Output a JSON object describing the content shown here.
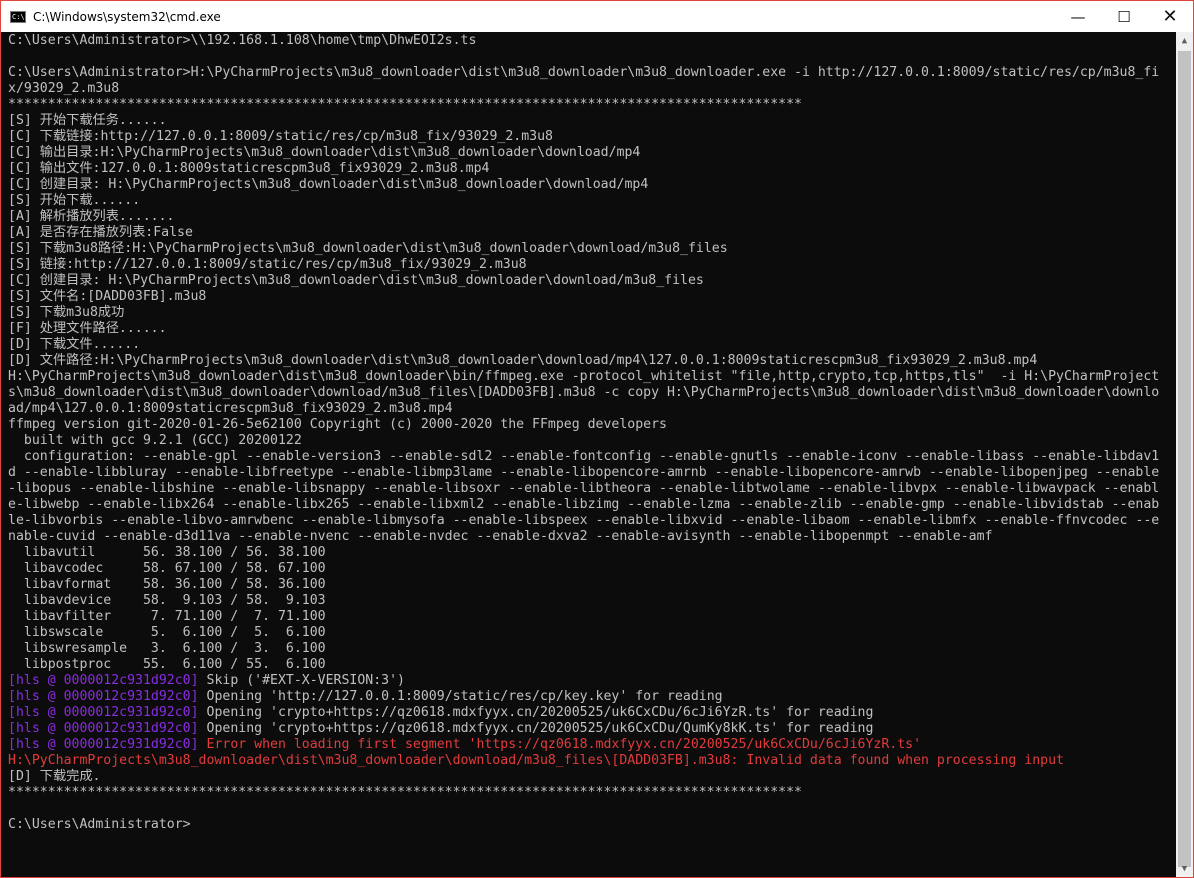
{
  "window": {
    "title": "C:\\Windows\\system32\\cmd.exe",
    "icon": "cmd-icon",
    "icon_glyph": "C:\\",
    "controls": {
      "minimize": "—",
      "maximize": "☐",
      "close": "✕"
    }
  },
  "colors": {
    "background": "#0c0c0c",
    "text": "#c0c0c0",
    "hls_tag": "#8a2be2",
    "error": "#e23b3b",
    "frame": "#e0443e"
  },
  "scrollbar": {
    "up": "▲",
    "down": "▼"
  },
  "console": {
    "lines": [
      {
        "text": "C:\\Users\\Administrator>\\\\192.168.1.108\\home\\tmp\\DhwEOI2s.ts"
      },
      {
        "text": ""
      },
      {
        "text": "C:\\Users\\Administrator>H:\\PyCharmProjects\\m3u8_downloader\\dist\\m3u8_downloader\\m3u8_downloader.exe -i http://127.0.0.1:8009/static/res/cp/m3u8_fi"
      },
      {
        "text": "x/93029_2.m3u8"
      },
      {
        "text": "****************************************************************************************************"
      },
      {
        "text": "[S] 开始下载任务......"
      },
      {
        "text": "[C] 下载链接:http://127.0.0.1:8009/static/res/cp/m3u8_fix/93029_2.m3u8"
      },
      {
        "text": "[C] 输出目录:H:\\PyCharmProjects\\m3u8_downloader\\dist\\m3u8_downloader\\download/mp4"
      },
      {
        "text": "[C] 输出文件:127.0.0.1:8009staticrescpm3u8_fix93029_2.m3u8.mp4"
      },
      {
        "text": "[C] 创建目录: H:\\PyCharmProjects\\m3u8_downloader\\dist\\m3u8_downloader\\download/mp4"
      },
      {
        "text": "[S] 开始下载......"
      },
      {
        "text": "[A] 解析播放列表......."
      },
      {
        "text": "[A] 是否存在播放列表:False"
      },
      {
        "text": "[S] 下载m3u8路径:H:\\PyCharmProjects\\m3u8_downloader\\dist\\m3u8_downloader\\download/m3u8_files"
      },
      {
        "text": "[S] 链接:http://127.0.0.1:8009/static/res/cp/m3u8_fix/93029_2.m3u8"
      },
      {
        "text": "[C] 创建目录: H:\\PyCharmProjects\\m3u8_downloader\\dist\\m3u8_downloader\\download/m3u8_files"
      },
      {
        "text": "[S] 文件名:[DADD03FB].m3u8"
      },
      {
        "text": "[S] 下载m3u8成功"
      },
      {
        "text": "[F] 处理文件路径......"
      },
      {
        "text": "[D] 下载文件......"
      },
      {
        "text": "[D] 文件路径:H:\\PyCharmProjects\\m3u8_downloader\\dist\\m3u8_downloader\\download/mp4\\127.0.0.1:8009staticrescpm3u8_fix93029_2.m3u8.mp4"
      },
      {
        "text": "H:\\PyCharmProjects\\m3u8_downloader\\dist\\m3u8_downloader\\bin/ffmpeg.exe -protocol_whitelist \"file,http,crypto,tcp,https,tls\"  -i H:\\PyCharmProject"
      },
      {
        "text": "s\\m3u8_downloader\\dist\\m3u8_downloader\\download/m3u8_files\\[DADD03FB].m3u8 -c copy H:\\PyCharmProjects\\m3u8_downloader\\dist\\m3u8_downloader\\downlo"
      },
      {
        "text": "ad/mp4\\127.0.0.1:8009staticrescpm3u8_fix93029_2.m3u8.mp4"
      },
      {
        "text": "ffmpeg version git-2020-01-26-5e62100 Copyright (c) 2000-2020 the FFmpeg developers"
      },
      {
        "text": "  built with gcc 9.2.1 (GCC) 20200122"
      },
      {
        "text": "  configuration: --enable-gpl --enable-version3 --enable-sdl2 --enable-fontconfig --enable-gnutls --enable-iconv --enable-libass --enable-libdav1"
      },
      {
        "text": "d --enable-libbluray --enable-libfreetype --enable-libmp3lame --enable-libopencore-amrnb --enable-libopencore-amrwb --enable-libopenjpeg --enable"
      },
      {
        "text": "-libopus --enable-libshine --enable-libsnappy --enable-libsoxr --enable-libtheora --enable-libtwolame --enable-libvpx --enable-libwavpack --enabl"
      },
      {
        "text": "e-libwebp --enable-libx264 --enable-libx265 --enable-libxml2 --enable-libzimg --enable-lzma --enable-zlib --enable-gmp --enable-libvidstab --enab"
      },
      {
        "text": "le-libvorbis --enable-libvo-amrwbenc --enable-libmysofa --enable-libspeex --enable-libxvid --enable-libaom --enable-libmfx --enable-ffnvcodec --e"
      },
      {
        "text": "nable-cuvid --enable-d3d11va --enable-nvenc --enable-nvdec --enable-dxva2 --enable-avisynth --enable-libopenmpt --enable-amf"
      },
      {
        "text": "  libavutil      56. 38.100 / 56. 38.100"
      },
      {
        "text": "  libavcodec     58. 67.100 / 58. 67.100"
      },
      {
        "text": "  libavformat    58. 36.100 / 58. 36.100"
      },
      {
        "text": "  libavdevice    58.  9.103 / 58.  9.103"
      },
      {
        "text": "  libavfilter     7. 71.100 /  7. 71.100"
      },
      {
        "text": "  libswscale      5.  6.100 /  5.  6.100"
      },
      {
        "text": "  libswresample   3.  6.100 /  3.  6.100"
      },
      {
        "text": "  libpostproc    55.  6.100 / 55.  6.100"
      },
      {
        "tag": "[hls @ 0000012c931d92c0]",
        "text": " Skip ('#EXT-X-VERSION:3')"
      },
      {
        "tag": "[hls @ 0000012c931d92c0]",
        "text": " Opening 'http://127.0.0.1:8009/static/res/cp/key.key' for reading"
      },
      {
        "tag": "[hls @ 0000012c931d92c0]",
        "text": " Opening 'crypto+https://qz0618.mdxfyyx.cn/20200525/uk6CxCDu/6cJi6YzR.ts' for reading"
      },
      {
        "tag": "[hls @ 0000012c931d92c0]",
        "text": " Opening 'crypto+https://qz0618.mdxfyyx.cn/20200525/uk6CxCDu/QumKy8kK.ts' for reading"
      },
      {
        "tag": "[hls @ 0000012c931d92c0]",
        "text": " Error when loading first segment 'https://qz0618.mdxfyyx.cn/20200525/uk6CxCDu/6cJi6YzR.ts'",
        "error": true
      },
      {
        "text": "H:\\PyCharmProjects\\m3u8_downloader\\dist\\m3u8_downloader\\download/m3u8_files\\[DADD03FB].m3u8: Invalid data found when processing input",
        "error": true
      },
      {
        "text": "[D] 下载完成."
      },
      {
        "text": "****************************************************************************************************"
      },
      {
        "text": ""
      },
      {
        "text": "C:\\Users\\Administrator>"
      }
    ]
  }
}
